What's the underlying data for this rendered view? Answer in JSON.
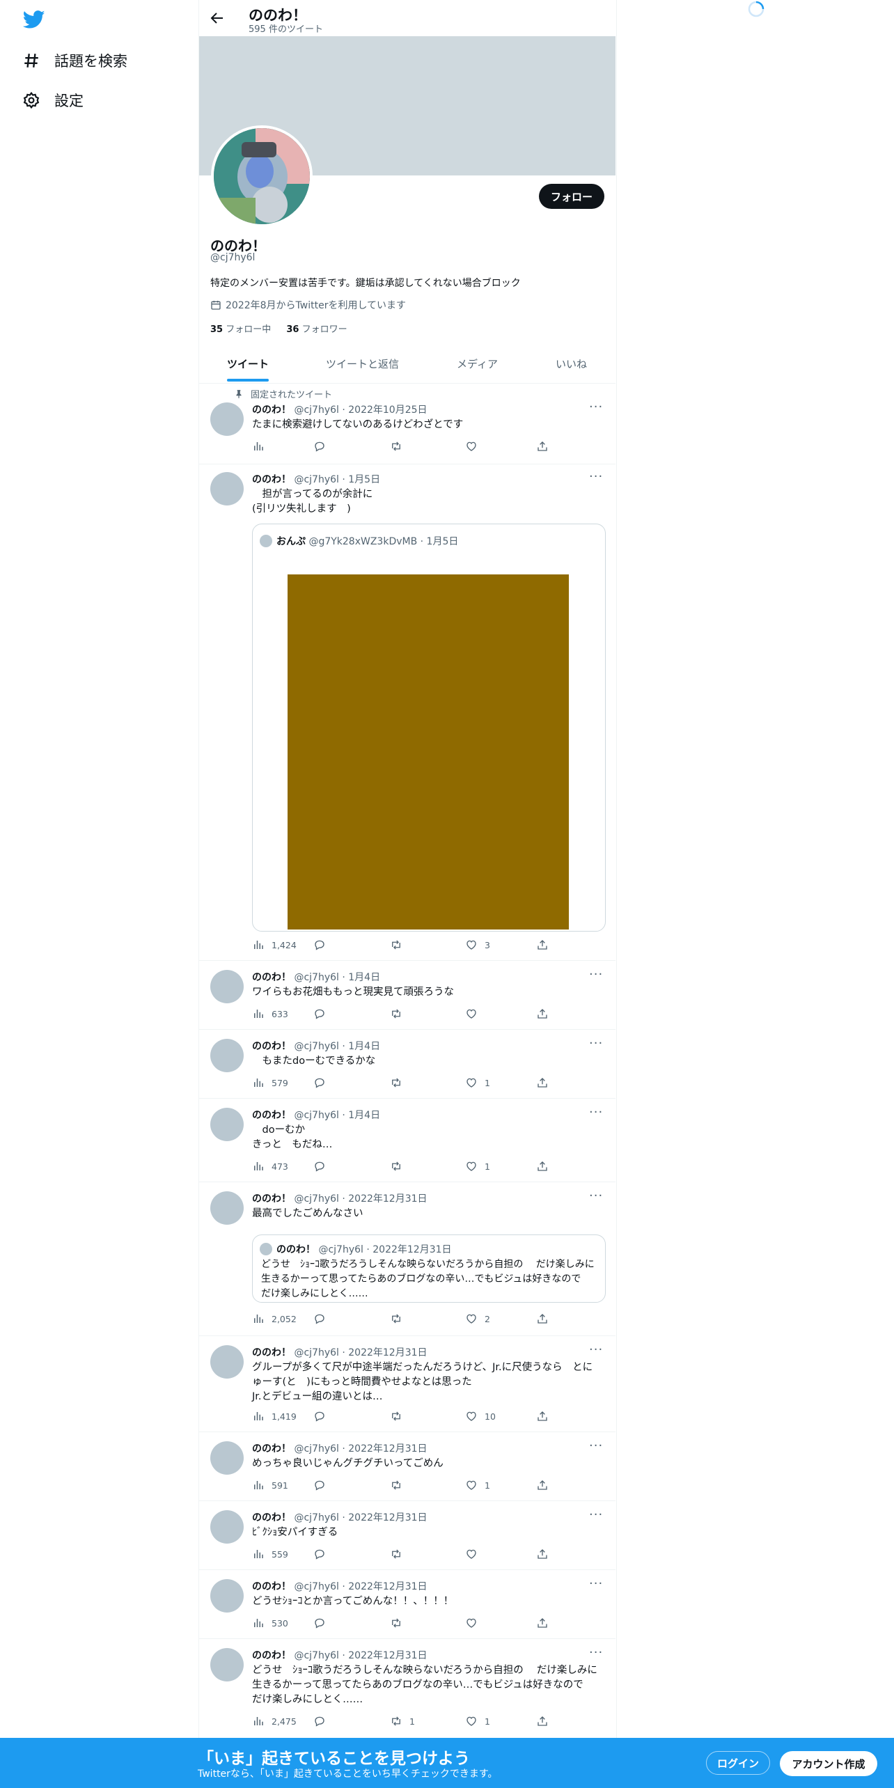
{
  "nav": {
    "explore_label": "話題を検索",
    "settings_label": "設定"
  },
  "header": {
    "title": "ののわ！",
    "subtitle": "595 件のツイート"
  },
  "profile": {
    "name": "ののわ！",
    "handle": "@cj7hy6l",
    "bio": "特定のメンバー安置は苦手です。鍵垢は承認してくれない場合ブロック",
    "joined": "2022年8月からTwitterを利用しています",
    "following_count": "35",
    "following_label": " フォロー中",
    "followers_count": "36",
    "followers_label": " フォロワー",
    "follow_button": "フォロー"
  },
  "tabs": [
    "ツイート",
    "ツイートと返信",
    "メディア",
    "いいね"
  ],
  "pinned_label": "固定されたツイート",
  "tweets": [
    {
      "name": "ののわ！",
      "meta": " @cj7hy6l · 2022年10月25日",
      "text": "たまに検索避けしてないのあるけどわざとです",
      "views": "",
      "replies": "",
      "retweets": "",
      "likes": ""
    },
    {
      "name": "ののわ！",
      "meta": " @cj7hy6l · 1月5日",
      "text": "　担が言ってるのが余計に\n(引リツ失礼します　)",
      "views": "1,424",
      "replies": "",
      "retweets": "",
      "likes": "3",
      "quote": {
        "name": "おんぷ",
        "meta": " @g7Yk28xWZ3kDvMB · 1月5日"
      }
    },
    {
      "name": "ののわ！",
      "meta": " @cj7hy6l · 1月4日",
      "text": "ワイらもお花畑ももっと現実見て頑張ろうな",
      "views": "633",
      "replies": "",
      "retweets": "",
      "likes": ""
    },
    {
      "name": "ののわ！",
      "meta": " @cj7hy6l · 1月4日",
      "text": "　もまたdoーむできるかな",
      "views": "579",
      "replies": "",
      "retweets": "",
      "likes": "1"
    },
    {
      "name": "ののわ！",
      "meta": " @cj7hy6l · 1月4日",
      "text": "　doーむか\nきっと　もだね…",
      "views": "473",
      "replies": "",
      "retweets": "",
      "likes": "1"
    },
    {
      "name": "ののわ！",
      "meta": " @cj7hy6l · 2022年12月31日",
      "text": "最高でしたごめんなさい",
      "views": "2,052",
      "replies": "",
      "retweets": "",
      "likes": "2",
      "quote": {
        "name": "ののわ！",
        "meta": " @cj7hy6l · 2022年12月31日",
        "text": "どうせ　ｼｮｰｺ歌うだろうしそんな映らないだろうから自担の　 だけ楽しみに生きるかーって思ってたらあのブログなの辛い…でもビジュは好きなので　 だけ楽しみにしとく……"
      }
    },
    {
      "name": "ののわ！",
      "meta": " @cj7hy6l · 2022年12月31日",
      "text": "グループが多くて尺が中途半端だったんだろうけど、Jr.に尺使うなら　とにゅーす(と　)にもっと時間費やせよなとは思った\nJr.とデビュー組の違いとは…",
      "views": "1,419",
      "replies": "",
      "retweets": "",
      "likes": "10"
    },
    {
      "name": "ののわ！",
      "meta": " @cj7hy6l · 2022年12月31日",
      "text": "めっちゃ良いじゃんグチグチいってごめん",
      "views": "591",
      "replies": "",
      "retweets": "",
      "likes": "1"
    },
    {
      "name": "ののわ！",
      "meta": " @cj7hy6l · 2022年12月31日",
      "text": "ﾋﾞｸｼｮ安パイすぎる",
      "views": "559",
      "replies": "",
      "retweets": "",
      "likes": ""
    },
    {
      "name": "ののわ！",
      "meta": " @cj7hy6l · 2022年12月31日",
      "text": "どうせｼｮｰｺとか言ってごめんな！！、！！！",
      "views": "530",
      "replies": "",
      "retweets": "",
      "likes": ""
    },
    {
      "name": "ののわ！",
      "meta": " @cj7hy6l · 2022年12月31日",
      "text": "どうせ　ｼｮｰｺ歌うだろうしそんな映らないだろうから自担の　 だけ楽しみに生きるかーって思ってたらあのブログなの辛い…でもビジュは好きなので　 だけ楽しみにしとく……",
      "views": "2,475",
      "replies": "",
      "retweets": "1",
      "likes": "1"
    }
  ],
  "bottom_bar": {
    "title": "「いま」起きていることを見つけよう",
    "subtitle": "Twitterなら、「いま」起きていることをいち早くチェックできます。",
    "login": "ログイン",
    "signup": "アカウント作成"
  },
  "colors": {
    "accent": "#1d9bf0",
    "banner": "#cfd9de",
    "quote_media": "#8f6a00"
  }
}
